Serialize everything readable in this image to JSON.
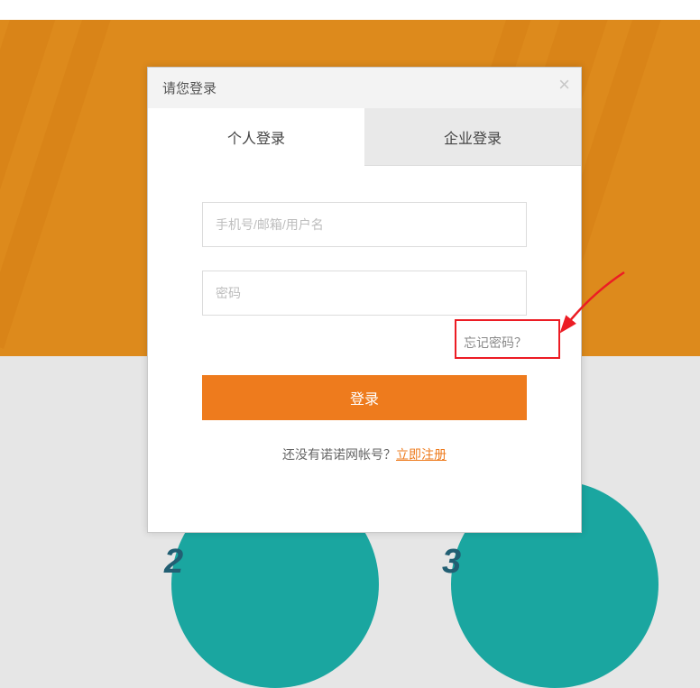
{
  "modal": {
    "title": "请您登录",
    "tabs": {
      "personal": "个人登录",
      "enterprise": "企业登录"
    },
    "form": {
      "username_placeholder": "手机号/邮箱/用户名",
      "password_placeholder": "密码",
      "forgot": "忘记密码？",
      "login_button": "登录",
      "register_prompt": "还没有诺诺网帐号？",
      "register_link": "立即注册"
    }
  },
  "steps": {
    "two": "2",
    "three": "3"
  }
}
